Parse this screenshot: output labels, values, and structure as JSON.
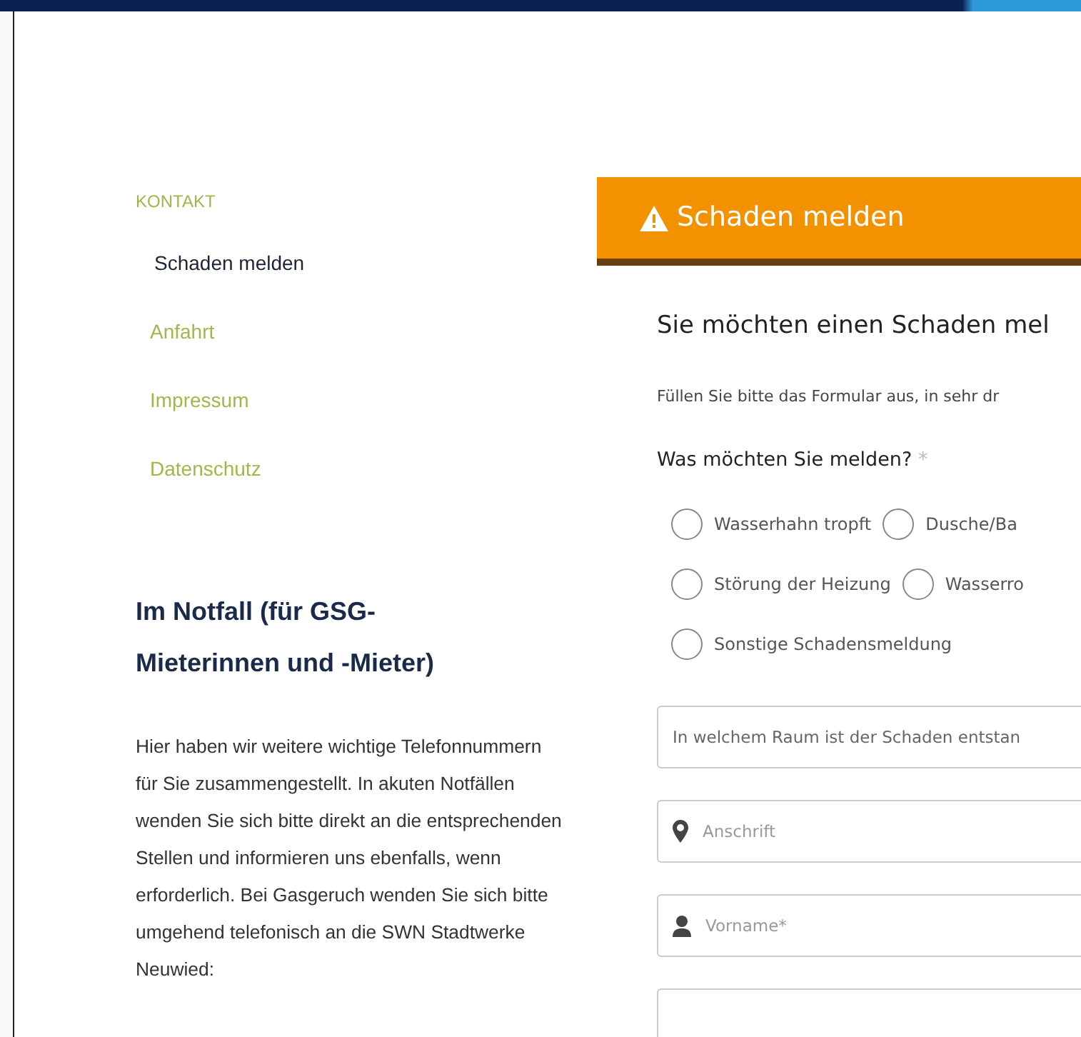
{
  "sidebar": {
    "heading": "KONTAKT",
    "items": [
      {
        "label": "Schaden melden",
        "selected": true
      },
      {
        "label": "Anfahrt",
        "selected": false
      },
      {
        "label": "Impressum",
        "selected": false
      },
      {
        "label": "Datenschutz",
        "selected": false
      }
    ],
    "emergency": {
      "title": "Im Notfall (für GSG-Mieterinnen und -Mieter)",
      "text": "Hier haben wir weitere wichtige Telefonnummern für Sie zusammengestellt. In akuten Notfällen wenden Sie sich bitte direkt an die entsprechenden Stellen und informieren uns ebenfalls, wenn erforderlich. Bei Gasgeruch wenden Sie sich bitte umgehend telefonisch an die SWN Stadtwerke Neuwied:"
    }
  },
  "panel": {
    "title": "Schaden melden",
    "heading": "Sie möchten einen Schaden mel",
    "intro": "Füllen Sie bitte das Formular aus, in sehr dr",
    "question": "Was möchten Sie melden?",
    "required_mark": "*",
    "options": [
      [
        {
          "label": "Wasserhahn tropft",
          "selected": false
        },
        {
          "label": "Dusche/Ba",
          "selected": false
        }
      ],
      [
        {
          "label": "Störung der Heizung",
          "selected": false
        },
        {
          "label": "Wasserro",
          "selected": false
        }
      ],
      [
        {
          "label": "Sonstige Schadensmeldung",
          "selected": false
        }
      ]
    ],
    "fields": [
      {
        "kind": "plain",
        "placeholder": "In welchem Raum ist der Schaden entstan"
      },
      {
        "kind": "address",
        "placeholder": "Anschrift"
      },
      {
        "kind": "person",
        "placeholder": "Vorname*"
      },
      {
        "kind": "blank"
      }
    ]
  }
}
